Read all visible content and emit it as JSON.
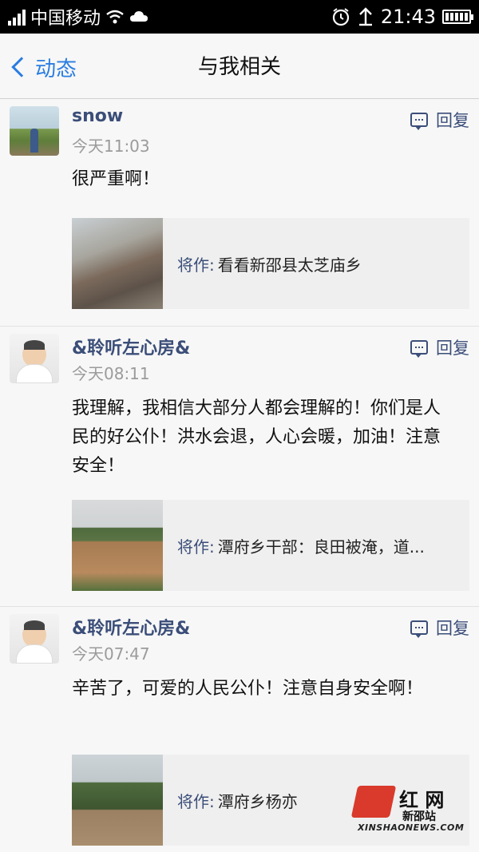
{
  "status_bar": {
    "carrier": "中国移动",
    "time": "21:43"
  },
  "nav": {
    "back_label": "动态",
    "title": "与我相关"
  },
  "feed": [
    {
      "user": "snow",
      "time": "今天11:03",
      "reply_label": "回复",
      "text": "很严重啊！",
      "card": {
        "prefix": "将作:",
        "title": "看看新邵县太芝庙乡"
      }
    },
    {
      "user": "&聆听左心房&",
      "time": "今天08:11",
      "reply_label": "回复",
      "text": "我理解，我相信大部分人都会理解的！你们是人民的好公仆！洪水会退，人心会暖，加油！注意安全！",
      "card": {
        "prefix": "将作:",
        "title": "潭府乡干部：良田被淹，道..."
      }
    },
    {
      "user": "&聆听左心房&",
      "time": "今天07:47",
      "reply_label": "回复",
      "text": "辛苦了，可爱的人民公仆！注意自身安全啊！",
      "card": {
        "prefix": "将作:",
        "title": "潭府乡杨亦"
      }
    }
  ],
  "watermark": {
    "name": "红 网",
    "site": "新邵站",
    "url": "XINSHAONEWS.COM"
  }
}
